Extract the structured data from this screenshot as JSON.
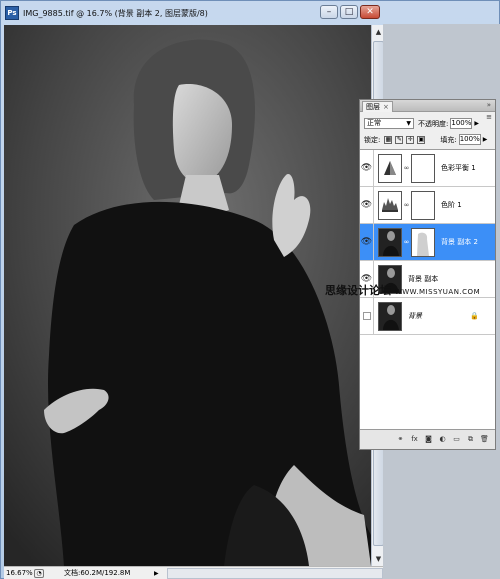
{
  "window": {
    "title": "IMG_9885.tif @ 16.7% (背景 副本 2, 图层蒙版/8)",
    "icon": "photoshop-doc-icon",
    "buttons": {
      "minimize": "–",
      "maximize": "□",
      "close": "✕"
    }
  },
  "status": {
    "zoom": "16.67%",
    "doc_size": "文档:60.2M/192.8M",
    "arrow": "▶"
  },
  "layers_panel": {
    "tab_label": "图层",
    "tab_close": "×",
    "blend_mode": "正常",
    "opacity_label": "不透明度:",
    "opacity_value": "100%",
    "lock_label": "锁定:",
    "fill_label": "填充:",
    "fill_value": "100%",
    "layers": [
      {
        "name": "色彩平衡 1",
        "visible": true,
        "type": "adjustment-color-balance",
        "has_mask": true,
        "selected": false
      },
      {
        "name": "色阶 1",
        "visible": true,
        "type": "adjustment-levels",
        "has_mask": true,
        "selected": false
      },
      {
        "name": "背景 副本 2",
        "visible": true,
        "type": "image",
        "has_mask": true,
        "selected": true
      },
      {
        "name": "背景 副本",
        "visible": true,
        "type": "image",
        "has_mask": false,
        "selected": false
      },
      {
        "name": "背景",
        "visible": false,
        "type": "image",
        "has_mask": false,
        "selected": false,
        "locked": true
      }
    ],
    "footer_icons": [
      "link-icon",
      "fx-icon",
      "mask-icon",
      "adjustment-icon",
      "folder-icon",
      "new-layer-icon",
      "trash-icon"
    ]
  },
  "watermark": {
    "cn": "思缘设计论坛",
    "en": "WWW.MISSYUAN.COM"
  },
  "colors": {
    "selection": "#3c8ff7",
    "canvas_bg": "#3b3b3b"
  }
}
